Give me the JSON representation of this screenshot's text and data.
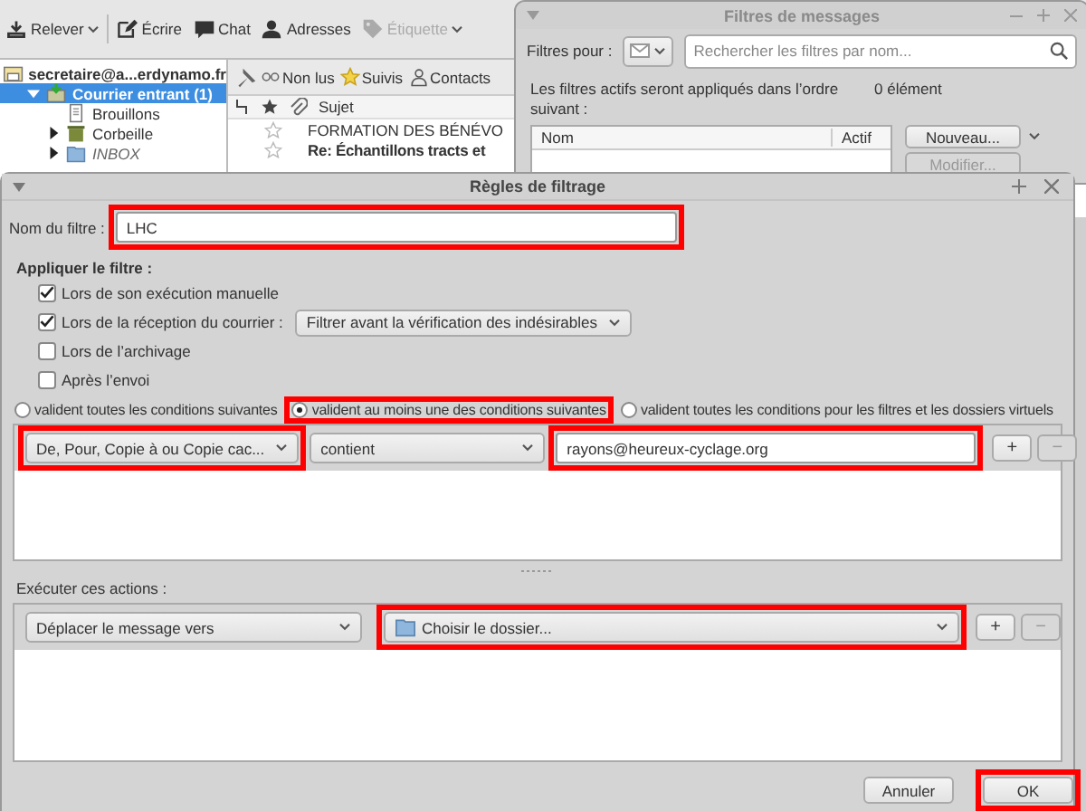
{
  "main_window": {
    "toolbar": [
      {
        "kind": "get",
        "label": "Relever",
        "menu": true,
        "disabled": false
      },
      {
        "kind": "write",
        "label": "Écrire",
        "menu": false,
        "disabled": false
      },
      {
        "kind": "chat",
        "label": "Chat",
        "menu": false,
        "disabled": false
      },
      {
        "kind": "contacts",
        "label": "Adresses",
        "menu": false,
        "disabled": false
      },
      {
        "kind": "tag",
        "label": "Étiquette",
        "menu": true,
        "disabled": true
      }
    ],
    "folder_pane": {
      "account": "secretaire@a...erdynamo.fr",
      "folders": [
        {
          "kind": "inbox",
          "label": "Courrier entrant (1)",
          "selected": true,
          "expanded": true,
          "unsynced": false,
          "children": [
            {
              "kind": "drafts",
              "label": "Brouillons",
              "selected": false,
              "unsynced": false
            },
            {
              "kind": "trash",
              "label": "Corbeille",
              "selected": false,
              "expanded": false,
              "unsynced": false
            },
            {
              "kind": "folder",
              "label": "INBOX",
              "selected": false,
              "expanded": false,
              "unsynced": true
            }
          ]
        }
      ]
    },
    "quick_filter": [
      {
        "kind": "unread",
        "label": "Non lus"
      },
      {
        "kind": "starred",
        "label": "Suivis"
      },
      {
        "kind": "contact",
        "label": "Contacts"
      }
    ],
    "message_list": {
      "subject_column": "Sujet",
      "rows": [
        {
          "subject": "FORMATION DES BÉNÉVO",
          "unread": false,
          "starred": false
        },
        {
          "subject": "Re: Échantillons tracts et",
          "unread": true,
          "starred": false
        }
      ]
    }
  },
  "filters_window": {
    "title": "Filtres de messages",
    "filters_for_label": "Filtres pour :",
    "search": {
      "placeholder": "Rechercher les filtres par nom..."
    },
    "info": "Les filtres actifs seront appliqués dans l’ordre suivant :",
    "count": "0 élément",
    "columns": [
      "Nom",
      "Actif"
    ],
    "buttons": [
      {
        "label": "Nouveau...",
        "menu": true,
        "disabled": false
      },
      {
        "label": "Modifier...",
        "menu": false,
        "disabled": true
      }
    ]
  },
  "rules_dialog": {
    "title": "Règles de filtrage",
    "name": {
      "label": "Nom du filtre :",
      "value": "LHC",
      "highlighted": true
    },
    "apply_heading": "Appliquer le filtre :",
    "apply_options": [
      {
        "label": "Lors de son exécution manuelle",
        "checked": true
      },
      {
        "label": "Lors de la réception du courrier :",
        "checked": true,
        "select": "Filtrer avant la vérification des indésirables"
      },
      {
        "label": "Lors de l’archivage",
        "checked": false
      },
      {
        "label": "Après l’envoi",
        "checked": false
      }
    ],
    "match_options": [
      {
        "label": "valident toutes les conditions suivantes",
        "selected": false,
        "highlighted": false
      },
      {
        "label": "valident au moins une des conditions suivantes",
        "selected": true,
        "highlighted": true
      },
      {
        "label": "valident toutes les conditions pour les filtres et les dossiers virtuels",
        "selected": false,
        "highlighted": false
      }
    ],
    "conditions": [
      {
        "field": "De, Pour, Copie à ou Copie cac...",
        "field_highlighted": true,
        "operator": "contient",
        "value": "rayons@heureux-cyclage.org",
        "value_highlighted": true,
        "add": "+",
        "remove": "−"
      }
    ],
    "actions_heading": "Exécuter ces actions :",
    "actions": [
      {
        "action": "Déplacer le message vers",
        "target": "Choisir le dossier...",
        "target_highlighted": true,
        "add": "+",
        "remove": "−"
      }
    ],
    "buttons": [
      {
        "label": "Annuler",
        "highlighted": false
      },
      {
        "label": "OK",
        "highlighted": true
      }
    ]
  }
}
